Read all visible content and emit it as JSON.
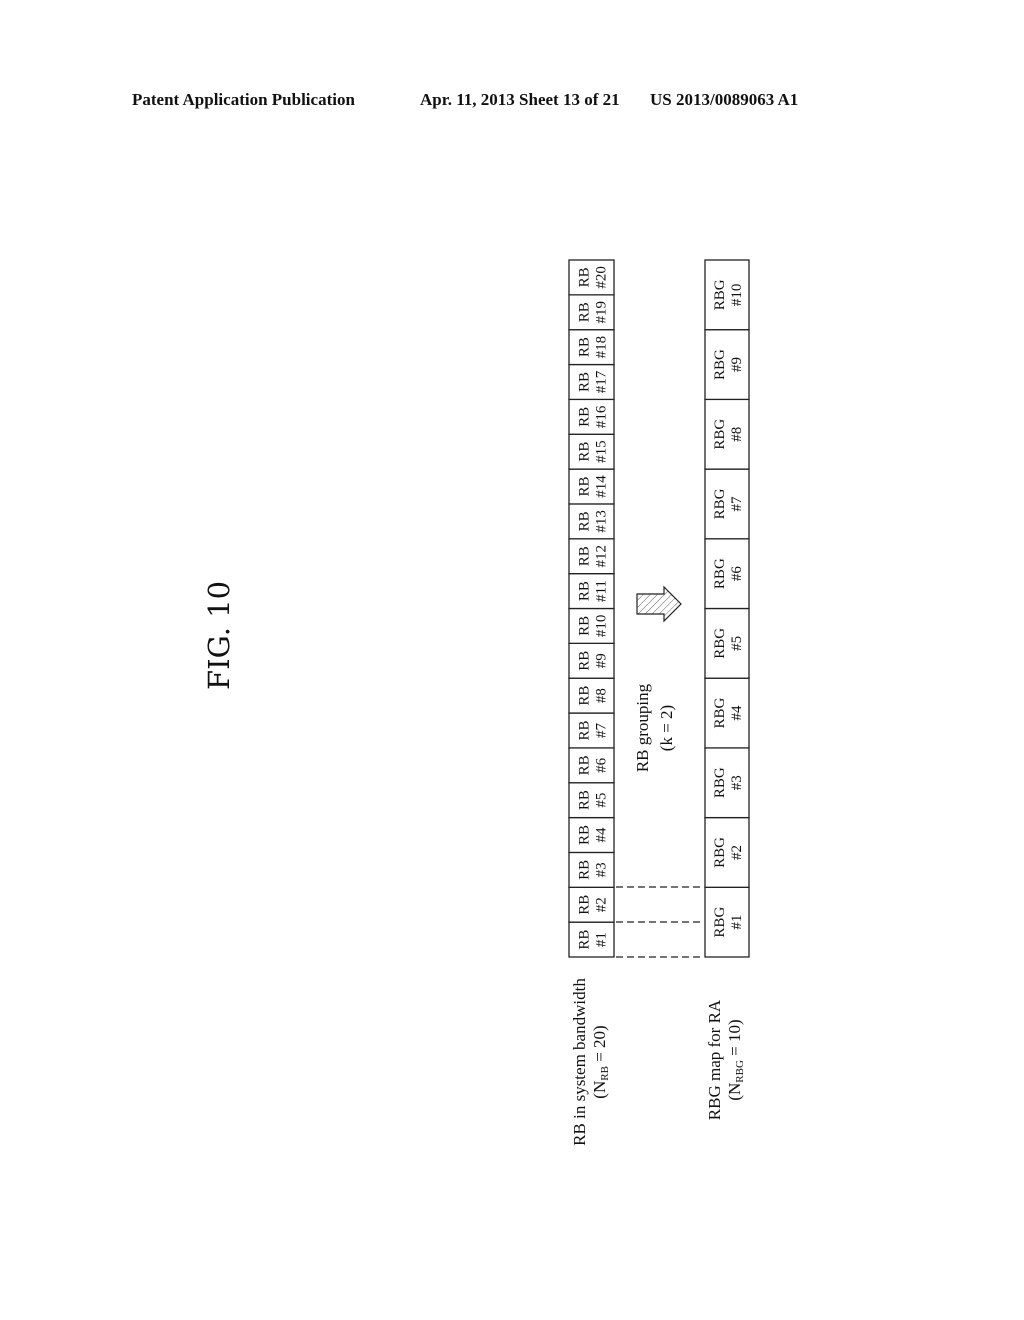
{
  "header": {
    "left": "Patent Application Publication",
    "middle": "Apr. 11, 2013  Sheet 13 of 21",
    "right": "US 2013/0089063 A1"
  },
  "figure": {
    "title": "FIG. 10",
    "rb_row": {
      "label_line1": "RB in system bandwidth",
      "label_line2_prefix": "(N",
      "label_line2_sub": "RB",
      "label_line2_suffix": " = 20)",
      "count": 20,
      "cells": [
        {
          "top": "RB",
          "bottom": "#1"
        },
        {
          "top": "RB",
          "bottom": "#2"
        },
        {
          "top": "RB",
          "bottom": "#3"
        },
        {
          "top": "RB",
          "bottom": "#4"
        },
        {
          "top": "RB",
          "bottom": "#5"
        },
        {
          "top": "RB",
          "bottom": "#6"
        },
        {
          "top": "RB",
          "bottom": "#7"
        },
        {
          "top": "RB",
          "bottom": "#8"
        },
        {
          "top": "RB",
          "bottom": "#9"
        },
        {
          "top": "RB",
          "bottom": "#10"
        },
        {
          "top": "RB",
          "bottom": "#11"
        },
        {
          "top": "RB",
          "bottom": "#12"
        },
        {
          "top": "RB",
          "bottom": "#13"
        },
        {
          "top": "RB",
          "bottom": "#14"
        },
        {
          "top": "RB",
          "bottom": "#15"
        },
        {
          "top": "RB",
          "bottom": "#16"
        },
        {
          "top": "RB",
          "bottom": "#17"
        },
        {
          "top": "RB",
          "bottom": "#18"
        },
        {
          "top": "RB",
          "bottom": "#19"
        },
        {
          "top": "RB",
          "bottom": "#20"
        }
      ]
    },
    "grouping": {
      "label_line1": "RB grouping",
      "label_line2": "(k = 2)"
    },
    "rbg_row": {
      "label_line1": "RBG map for RA",
      "label_line2_prefix": "(N",
      "label_line2_sub": "RBG",
      "label_line2_suffix": " = 10)",
      "count": 10,
      "cells": [
        {
          "top": "RBG",
          "bottom": "#1"
        },
        {
          "top": "RBG",
          "bottom": "#2"
        },
        {
          "top": "RBG",
          "bottom": "#3"
        },
        {
          "top": "RBG",
          "bottom": "#4"
        },
        {
          "top": "RBG",
          "bottom": "#5"
        },
        {
          "top": "RBG",
          "bottom": "#6"
        },
        {
          "top": "RBG",
          "bottom": "#7"
        },
        {
          "top": "RBG",
          "bottom": "#8"
        },
        {
          "top": "RBG",
          "bottom": "#9"
        },
        {
          "top": "RBG",
          "bottom": "#10"
        }
      ]
    }
  }
}
